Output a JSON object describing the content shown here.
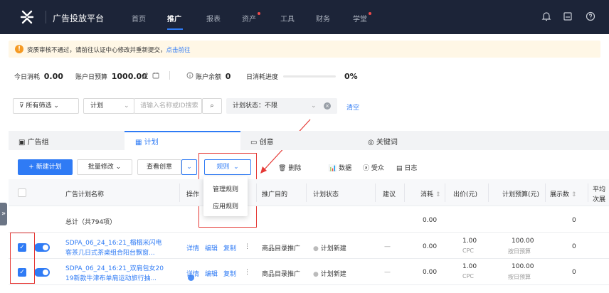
{
  "nav": {
    "brand": "广告投放平台",
    "items": [
      "首页",
      "推广",
      "报表",
      "资产",
      "工具",
      "财务",
      "学堂"
    ]
  },
  "icons": {
    "bell": "bell-icon",
    "save": "save-icon",
    "help": "help-icon"
  },
  "alert": {
    "text": "资质审核不通过，请前往认证中心修改并重新提交，",
    "link": "点击前往"
  },
  "stats": {
    "today_label": "今日消耗",
    "today_value": "0.00",
    "budget_label": "账户日预算",
    "budget_value": "1000.00",
    "balance_label": "账户余额",
    "balance_value": "0",
    "progress_label": "日消耗进度",
    "progress_value": "0%",
    "progress_fraction": 0
  },
  "filters": {
    "all_filters": "所有筛选",
    "plan_select": "计划",
    "search_placeholder": "请输入名称或ID搜索",
    "status_filter": "计划状态：不限",
    "clear": "清空"
  },
  "tabs": [
    "广告组",
    "计划",
    "创意",
    "关键词"
  ],
  "toolbar": {
    "new_plan": "+ 新建计划",
    "batch_edit": "批量修改",
    "view_creative": "查看创意",
    "rules": "规则",
    "delete": "删除",
    "data": "数据",
    "audience": "受众",
    "log": "日志"
  },
  "rules_menu": [
    "管理规则",
    "应用规则"
  ],
  "table": {
    "headers": [
      "广告计划名称",
      "操作",
      "推广目的",
      "计划状态",
      "建议",
      "消耗",
      "出价(元)",
      "计划预算(元)",
      "展示数",
      "平均",
      "次展"
    ],
    "total": {
      "label": "总计（共794项）",
      "spend": "0.00",
      "impressions": "0"
    },
    "rows": [
      {
        "name_line1": "SDPA_06_24_16:21_榻榻米闪电",
        "name_line2": "客茶几日式茶桌组合阳台飘窗...",
        "ops": [
          "详情",
          "编辑",
          "复制"
        ],
        "more": "⋮",
        "goal": "商品目录推广",
        "status": "计划新建",
        "suggest": "—",
        "spend": "0.00",
        "bid": "1.00",
        "bid_type": "CPC",
        "budget": "100.00",
        "budget_type": "按日预算",
        "impressions": "0"
      },
      {
        "name_line1": "SDPA_06_24_16:21_双肩包女20",
        "name_line2": "19新款牛津布单肩运动旅行抽...",
        "ops": [
          "详情",
          "编辑",
          "复制"
        ],
        "more": "⋮",
        "goal": "商品目录推广",
        "status": "计划新建",
        "suggest": "—",
        "spend": "0.00",
        "bid": "1.00",
        "bid_type": "CPC",
        "budget": "100.00",
        "budget_type": "按日预算",
        "impressions": "0"
      }
    ]
  },
  "colors": {
    "accent": "#2f7bf5",
    "nav_bg": "#1c2438",
    "highlight": "#e53935"
  }
}
